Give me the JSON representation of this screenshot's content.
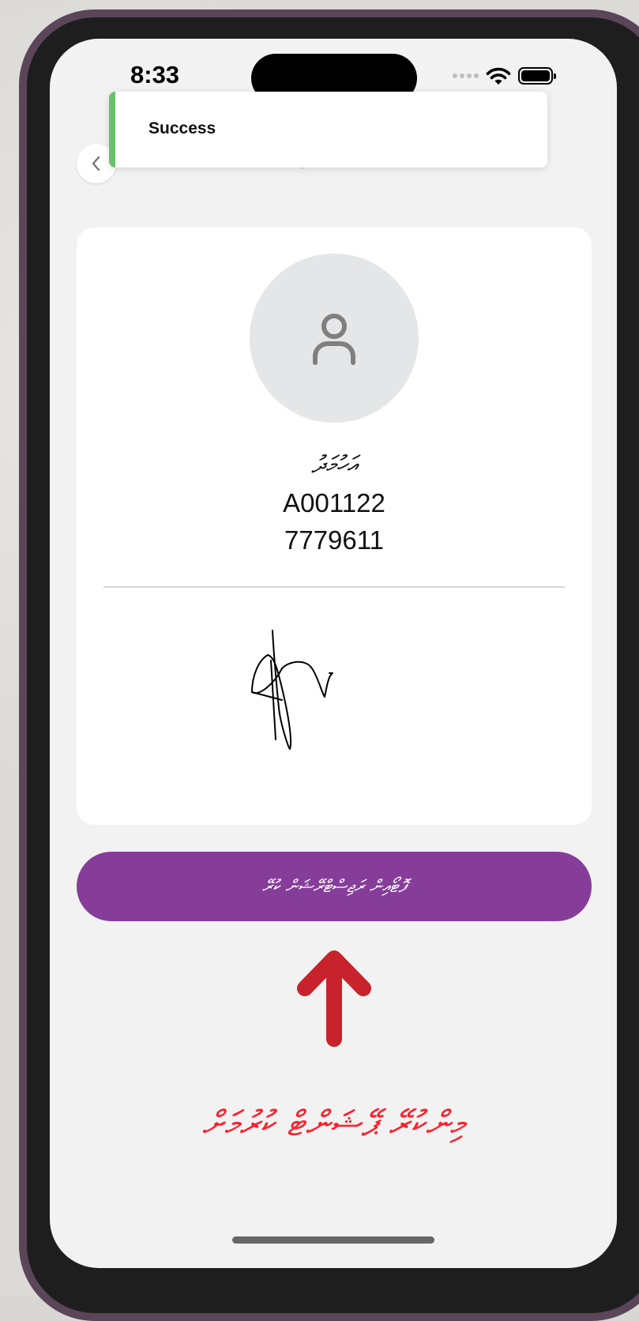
{
  "status_bar": {
    "time": "8:33"
  },
  "toast": {
    "message": "Success",
    "accent_color": "#69c16b"
  },
  "header": {
    "back_icon": "chevron-left-icon"
  },
  "profile": {
    "avatar_icon": "user-icon",
    "name": "އަހުމަދު",
    "id_number": "A001122",
    "phone": "7779611"
  },
  "signature": {
    "type": "handwritten-signature"
  },
  "primary_action": {
    "label": "ފޮޓޯއިން ރަޖިސްޓްރޭޝަން ކުރޭ",
    "color": "#863d99"
  },
  "annotation": {
    "arrow_icon": "arrow-up-icon",
    "text": "މިންކުރޭ ޕޭޝަންޓް ކުރުމަށް",
    "color": "#ff1f2c"
  }
}
